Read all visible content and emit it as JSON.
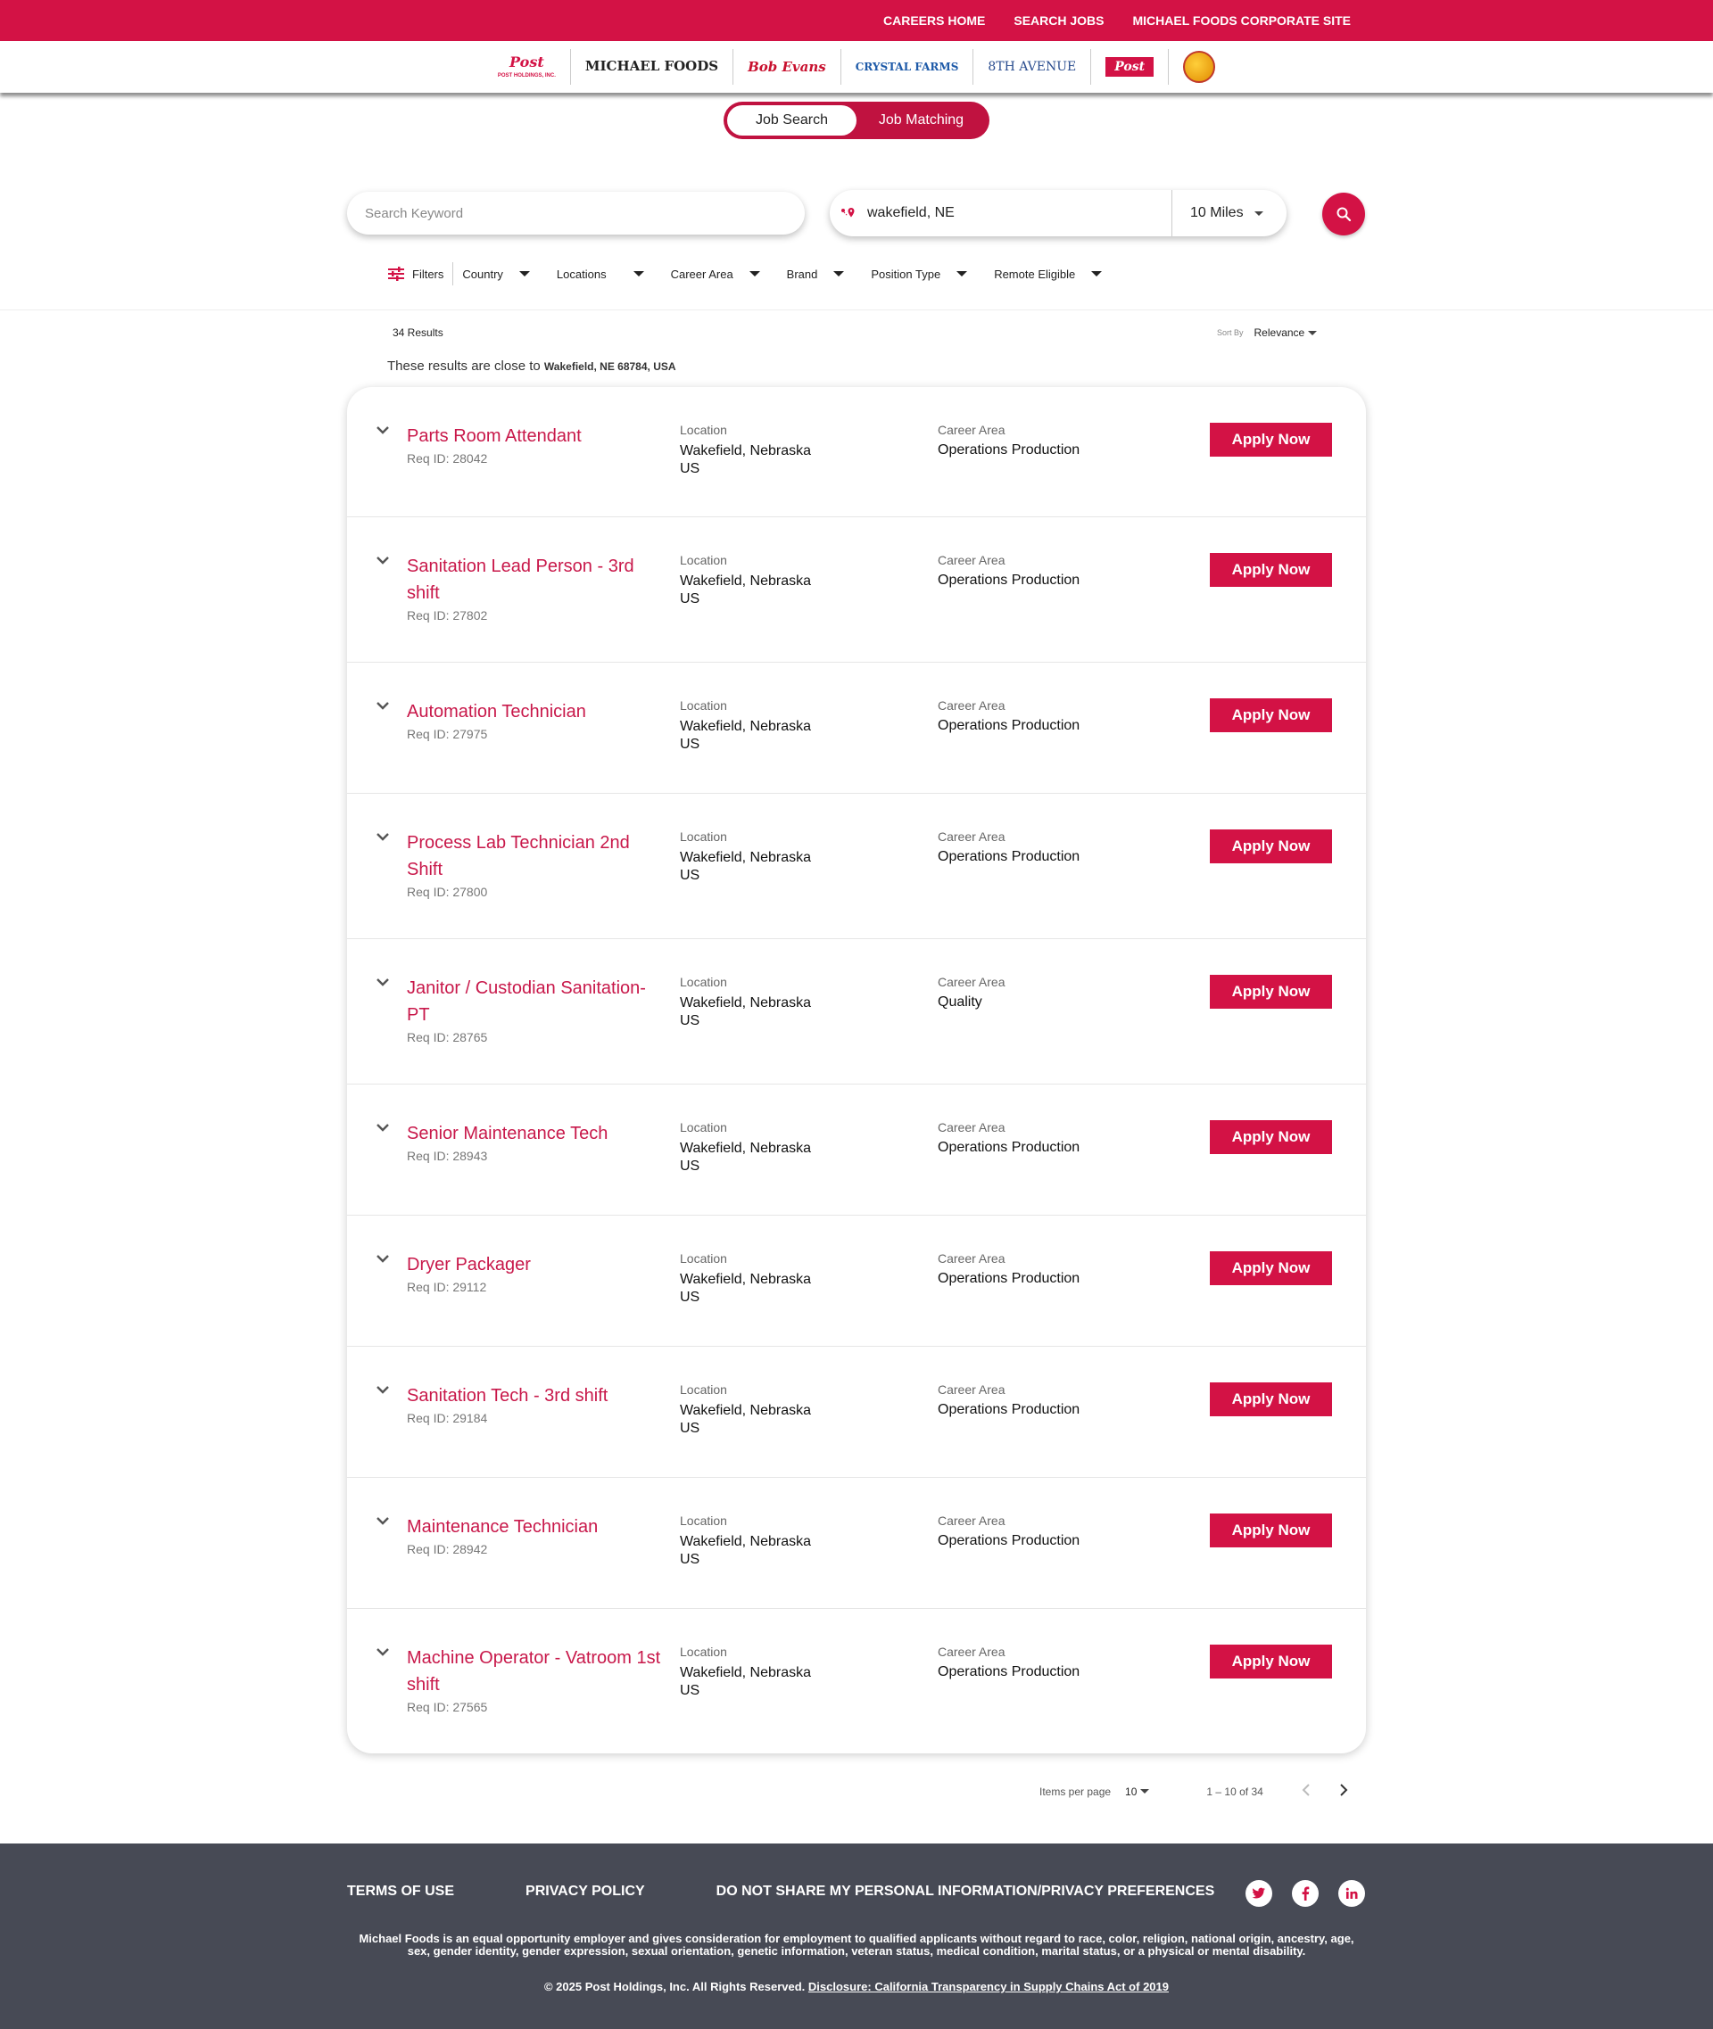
{
  "topnav": {
    "careers_home": "CAREERS HOME",
    "search_jobs": "SEARCH JOBS",
    "corporate_site": "MICHAEL FOODS CORPORATE SITE"
  },
  "brands": {
    "post": "Post",
    "post_sub": "POST HOLDINGS, INC.",
    "michael": "MICHAEL FOODS",
    "bob_evans": "Bob Evans",
    "crystal": "CRYSTAL FARMS",
    "avenue": "8TH AVENUE",
    "post_brands": "Post"
  },
  "toggle": {
    "job_search": "Job Search",
    "job_matching": "Job Matching"
  },
  "search": {
    "keyword_placeholder": "Search Keyword",
    "location": "wakefield, NE",
    "radius": "10 Miles"
  },
  "filters": {
    "label": "Filters",
    "dropdowns": [
      "Country",
      "Locations",
      "Career Area",
      "Brand",
      "Position Type",
      "Remote Eligible"
    ]
  },
  "results": {
    "count": "34 Results",
    "sort_label": "Sort By",
    "sort_value": "Relevance",
    "close_to_text": "These results are close to",
    "close_to_place": "Wakefield, NE 68784, USA"
  },
  "job_labels": {
    "location": "Location",
    "career_area": "Career Area",
    "apply": "Apply Now"
  },
  "jobs": [
    {
      "title": "Parts Room Attendant",
      "req": "Req ID: 28042",
      "city": "Wakefield, Nebraska",
      "country": "US",
      "area": "Operations Production"
    },
    {
      "title": "Sanitation Lead Person - 3rd shift",
      "req": "Req ID: 27802",
      "city": "Wakefield, Nebraska",
      "country": "US",
      "area": "Operations Production"
    },
    {
      "title": "Automation Technician",
      "req": "Req ID: 27975",
      "city": "Wakefield, Nebraska",
      "country": "US",
      "area": "Operations Production"
    },
    {
      "title": "Process Lab Technician 2nd Shift",
      "req": "Req ID: 27800",
      "city": "Wakefield, Nebraska",
      "country": "US",
      "area": "Operations Production"
    },
    {
      "title": "Janitor / Custodian Sanitation-PT",
      "req": "Req ID: 28765",
      "city": "Wakefield, Nebraska",
      "country": "US",
      "area": "Quality"
    },
    {
      "title": "Senior Maintenance Tech",
      "req": "Req ID: 28943",
      "city": "Wakefield, Nebraska",
      "country": "US",
      "area": "Operations Production"
    },
    {
      "title": "Dryer Packager",
      "req": "Req ID: 29112",
      "city": "Wakefield, Nebraska",
      "country": "US",
      "area": "Operations Production"
    },
    {
      "title": "Sanitation Tech - 3rd shift",
      "req": "Req ID: 29184",
      "city": "Wakefield, Nebraska",
      "country": "US",
      "area": "Operations Production"
    },
    {
      "title": "Maintenance Technician",
      "req": "Req ID: 28942",
      "city": "Wakefield, Nebraska",
      "country": "US",
      "area": "Operations Production"
    },
    {
      "title": "Machine Operator - Vatroom 1st shift",
      "req": "Req ID: 27565",
      "city": "Wakefield, Nebraska",
      "country": "US",
      "area": "Operations Production"
    }
  ],
  "pagination": {
    "items_per_page_label": "Items per page",
    "items_per_page": "10",
    "range": "1 – 10 of 34"
  },
  "footer": {
    "terms": "TERMS OF USE",
    "privacy": "PRIVACY POLICY",
    "do_not_share": "DO NOT SHARE MY PERSONAL INFORMATION/PRIVACY PREFERENCES",
    "eeo": "Michael Foods is an equal opportunity employer and gives consideration for employment to qualified applicants without regard to race, color, religion, national origin, ancestry, age, sex, gender identity, gender expression, sexual orientation, genetic information, veteran status, medical condition, marital status, or a physical or mental disability.",
    "copyright": "© 2025 Post Holdings, Inc. All Rights Reserved.",
    "disclosure": "Disclosure: California Transparency in Supply Chains Act of 2019"
  },
  "colors": {
    "brand_red": "#d31245",
    "footer_bg": "#474a55"
  },
  "icons": [
    "chevron-down-icon",
    "search-icon",
    "location-pin-icon",
    "filter-icon",
    "twitter-icon",
    "facebook-icon",
    "linkedin-icon",
    "chevron-left-icon",
    "chevron-right-icon"
  ]
}
